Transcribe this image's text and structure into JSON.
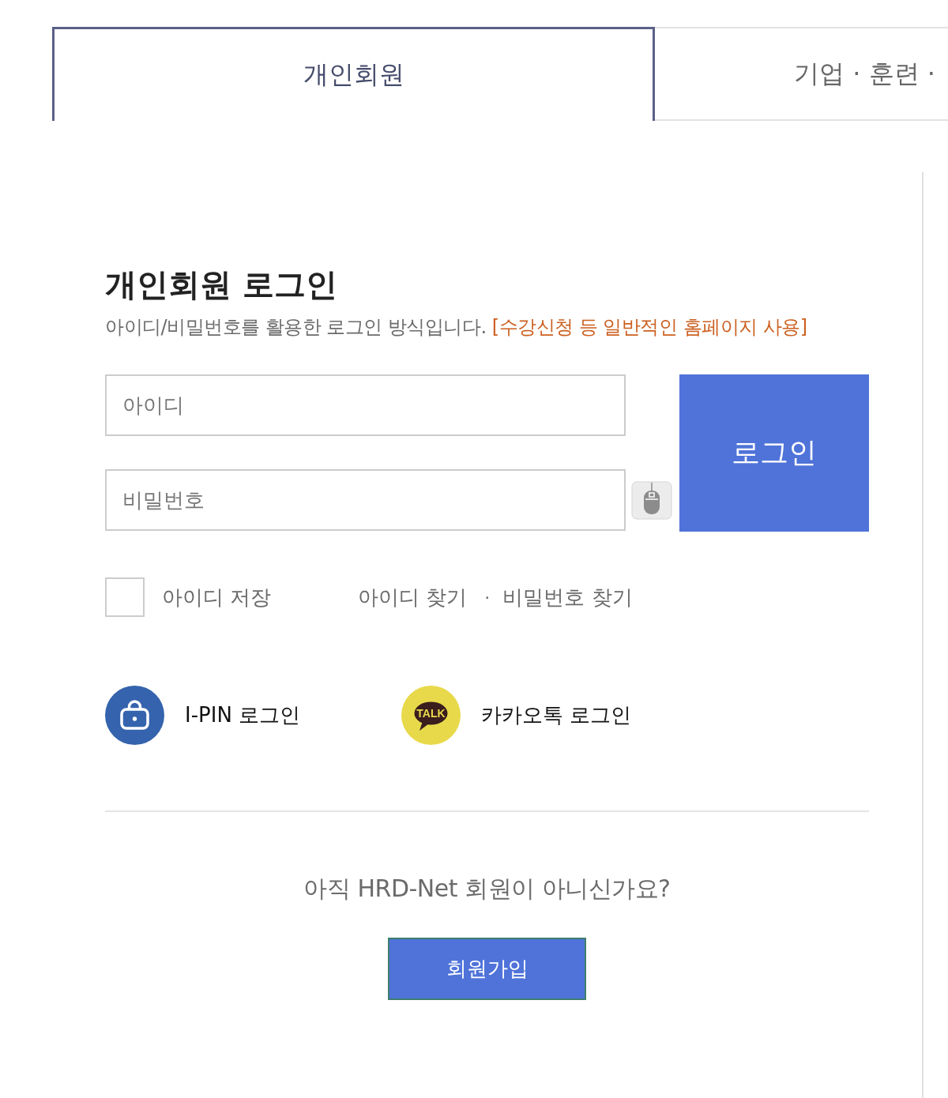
{
  "tabs": [
    {
      "label": "개인회원",
      "selected": true
    },
    {
      "label": "기업 · 훈련 ·",
      "selected": false
    }
  ],
  "login": {
    "title": "개인회원 로그인",
    "description": "아이디/비밀번호를 활용한 로그인 방식입니다.",
    "note": "[수강신청 등 일반적인 홈페이지 사용]",
    "fields": [
      {
        "kind": "id",
        "placeholder": "아이디"
      },
      {
        "kind": "password",
        "placeholder": "비밀번호"
      }
    ],
    "login_button": "로그인",
    "remember": {
      "label": "아이디 저장",
      "checked": false
    },
    "links": [
      "아이디 찾기",
      "비밀번호 찾기"
    ],
    "link_separator": "·",
    "social": [
      {
        "kind": "ipin",
        "label": "I-PIN 로그인"
      },
      {
        "kind": "kakao",
        "label": "카카오톡 로그인",
        "badge": "TALK"
      }
    ]
  },
  "signup": {
    "question": "아직 HRD-Net 회원이 아니신가요?",
    "button": "회원가입"
  }
}
